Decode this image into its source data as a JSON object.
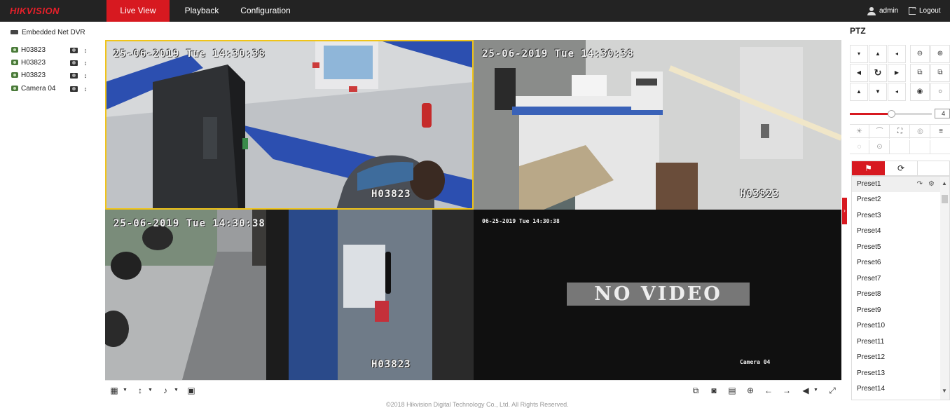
{
  "header": {
    "logo": "HIKVISION",
    "tabs": [
      {
        "label": "Live View",
        "active": true
      },
      {
        "label": "Playback",
        "active": false
      },
      {
        "label": "Configuration",
        "active": false
      }
    ],
    "user": "admin",
    "logout": "Logout",
    "accent_color": "#d71920"
  },
  "device_tree": {
    "root": "Embedded Net DVR",
    "cameras": [
      {
        "name": "H03823"
      },
      {
        "name": "H03823"
      },
      {
        "name": "H03823"
      },
      {
        "name": "Camera 04"
      }
    ]
  },
  "video": {
    "tiles": [
      {
        "timestamp": "25-06-2019 Tue 14:30:38",
        "label": "H03823",
        "selected": true
      },
      {
        "timestamp": "25-06-2019 Tue 14:30:38",
        "label": "H03823",
        "selected": false
      },
      {
        "timestamp": "25-06-2019 Tue 14:30:38",
        "label": "H03823",
        "selected": false
      },
      {
        "timestamp": "06-25-2019 Tue 14:30:38",
        "label": "Camera 04",
        "no_video": "NO VIDEO",
        "selected": false
      }
    ]
  },
  "toolbar": {
    "left_icons": [
      "window-layout-icon",
      "ptz-control-icon",
      "microphone-icon",
      "digital-zoom-icon"
    ],
    "right_icons": [
      "stop-all-icon",
      "capture-icon",
      "record-icon",
      "zoom-in-icon",
      "prev-page-icon",
      "next-page-icon",
      "volume-icon",
      "fullscreen-icon"
    ]
  },
  "footer": "©2018 Hikvision Digital Technology Co., Ltd. All Rights Reserved.",
  "ptz": {
    "title": "PTZ",
    "speed_value": "4",
    "speed_level": 0.5,
    "presets_tab_icon": "flag-icon",
    "patrol_tab_icon": "refresh-icon",
    "presets": [
      "Preset1",
      "Preset2",
      "Preset3",
      "Preset4",
      "Preset5",
      "Preset6",
      "Preset7",
      "Preset8",
      "Preset9",
      "Preset10",
      "Preset11",
      "Preset12",
      "Preset13",
      "Preset14"
    ]
  }
}
